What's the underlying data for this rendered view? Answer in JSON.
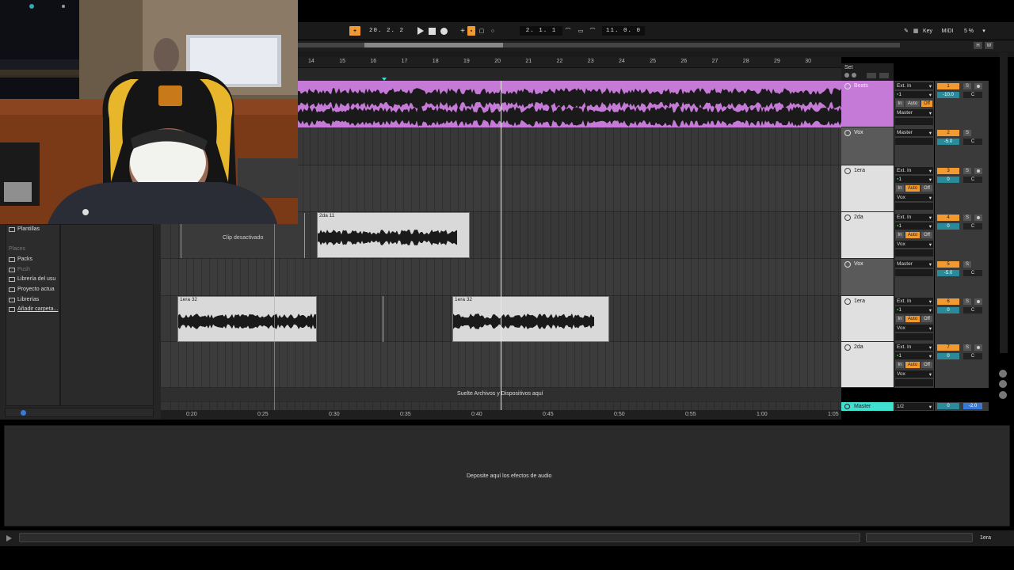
{
  "transport": {
    "tempo_button": "+",
    "position": "20.  2.  2",
    "loop_start": "2.  1.  1",
    "loop_length": "11.  0.  0",
    "key_label": "Key",
    "midi_label": "MIDI",
    "cpu": "5 %"
  },
  "overview": {
    "h_label": "H",
    "w_label": "W"
  },
  "ruler": {
    "bars": [
      "14",
      "15",
      "16",
      "17",
      "18",
      "19",
      "20",
      "21",
      "22",
      "23",
      "24",
      "25",
      "26",
      "27",
      "28",
      "29",
      "30"
    ],
    "set_label": "Set"
  },
  "time_ruler": [
    "0:20",
    "0:25",
    "0:30",
    "0:35",
    "0:40",
    "0:45",
    "0:50",
    "0:55",
    "1:00",
    "1:05"
  ],
  "browser": {
    "categories": [
      {
        "label": "Plantillas",
        "muted": false
      },
      {
        "label": "Places",
        "muted": true,
        "header": true
      },
      {
        "label": "Packs",
        "muted": false
      },
      {
        "label": "Push",
        "muted": true
      },
      {
        "label": "Librería del usu",
        "muted": false
      },
      {
        "label": "Proyecto actua",
        "muted": false
      },
      {
        "label": "Librerías",
        "muted": false
      },
      {
        "label": "Añadir carpeta...",
        "muted": false
      }
    ]
  },
  "clips": {
    "disabled_label": "Clip desactivado",
    "clip_2da": "2da 11",
    "clip_1era_a": "1era 32",
    "clip_1era_b": "1era 32",
    "drop_label": "Suelte Archivos y Dispositivos aquí"
  },
  "tracks": [
    {
      "name": "Beats",
      "input": "Ext. In",
      "channel": "1",
      "monitor": [
        "In",
        "Auto",
        "Off"
      ],
      "output": "Master",
      "number": "1",
      "volume": "-10.0",
      "pan": "C",
      "color": "#c67ad7"
    },
    {
      "name": "Vox",
      "input": "Master",
      "number": "2",
      "volume": "-5.0",
      "pan": "C",
      "color": "#5a5a5a"
    },
    {
      "name": "1era",
      "input": "Ext. In",
      "channel": "1",
      "monitor": [
        "In",
        "Auto",
        "Off"
      ],
      "output": "Vox",
      "number": "3",
      "volume": "0",
      "pan": "C",
      "color": "#e0e0e0"
    },
    {
      "name": "2da",
      "input": "Ext. In",
      "channel": "1",
      "monitor": [
        "In",
        "Auto",
        "Off"
      ],
      "output": "Vox",
      "number": "4",
      "volume": "0",
      "pan": "C",
      "color": "#e0e0e0"
    },
    {
      "name": "Vox",
      "input": "Master",
      "number": "5",
      "volume": "-5.0",
      "pan": "C",
      "color": "#5a5a5a"
    },
    {
      "name": "1era",
      "input": "Ext. In",
      "channel": "1",
      "monitor": [
        "In",
        "Auto",
        "Off"
      ],
      "output": "Vox",
      "number": "6",
      "volume": "0",
      "pan": "C",
      "color": "#e0e0e0"
    },
    {
      "name": "2da",
      "input": "Ext. In",
      "channel": "1",
      "monitor": [
        "In",
        "Auto",
        "Off"
      ],
      "output": "Vox",
      "number": "7",
      "volume": "0",
      "pan": "C",
      "color": "#e0e0e0"
    }
  ],
  "master": {
    "name": "Master",
    "output": "1/2",
    "volume": "0",
    "pan": "-2.0"
  },
  "devices": {
    "drop_label": "Deposite aquí los efectos de audio"
  },
  "status": {
    "selected_track": "1era"
  },
  "colors": {
    "accent_orange": "#f29a2f",
    "beats_purple": "#c67ad7",
    "master_teal": "#3fe0d0"
  }
}
